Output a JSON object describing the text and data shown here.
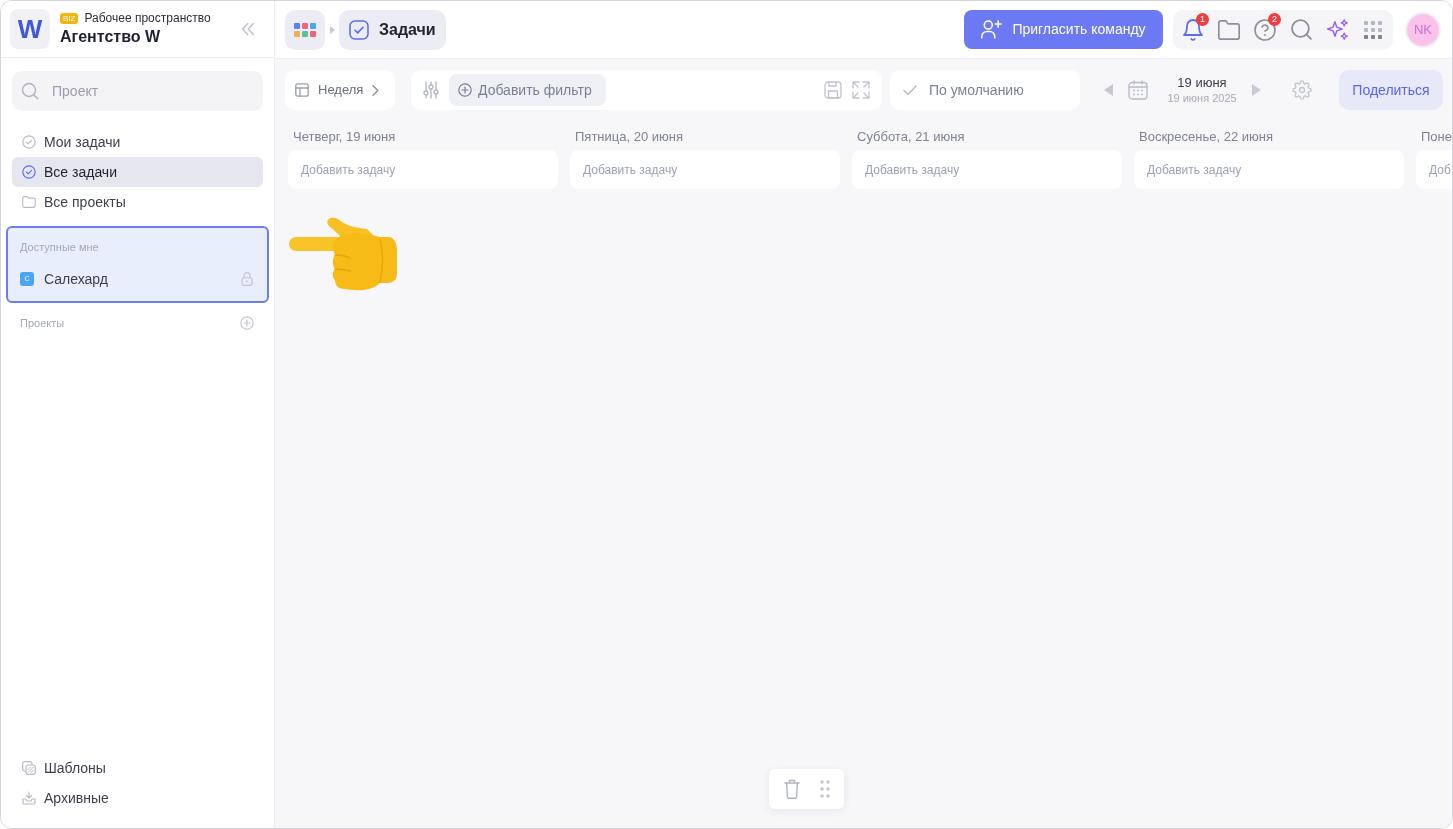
{
  "workspace": {
    "logo": "W",
    "badge": "BIZ",
    "label": "Рабочее пространство",
    "name": "Агентство W"
  },
  "sidebar": {
    "search": {
      "placeholder": "Проект"
    },
    "nav": [
      {
        "label": "Мои задачи",
        "selected": false
      },
      {
        "label": "Все задачи",
        "selected": true
      },
      {
        "label": "Все проекты",
        "selected": false
      }
    ],
    "shared": {
      "title": "Доступные мне",
      "highlighted": true,
      "items": [
        {
          "label": "Салехард",
          "initial": "С",
          "locked": true
        }
      ]
    },
    "projects": {
      "title": "Проекты"
    },
    "footer": [
      {
        "label": "Шаблоны"
      },
      {
        "label": "Архивные"
      }
    ]
  },
  "topbar": {
    "breadcrumb": "Задачи",
    "invite_button": "Пригласить команду",
    "notifications_badge": "1",
    "help_badge": "2",
    "avatar": "NK"
  },
  "toolbar": {
    "view": "Неделя",
    "add_filter": "Добавить фильтр",
    "sort": "По умолчанию",
    "date": {
      "title": "19 июня",
      "subtitle": "19 июня 2025"
    },
    "share_button": "Поделиться"
  },
  "days": [
    {
      "heading": "Четверг, 19 июня",
      "placeholder": "Добавить задачу"
    },
    {
      "heading": "Пятница, 20 июня",
      "placeholder": "Добавить задачу"
    },
    {
      "heading": "Суббота, 21 июня",
      "placeholder": "Добавить задачу"
    },
    {
      "heading": "Воскресенье, 22 июня",
      "placeholder": "Добавить задачу"
    },
    {
      "heading": "Поне",
      "placeholder": "Доб"
    }
  ]
}
